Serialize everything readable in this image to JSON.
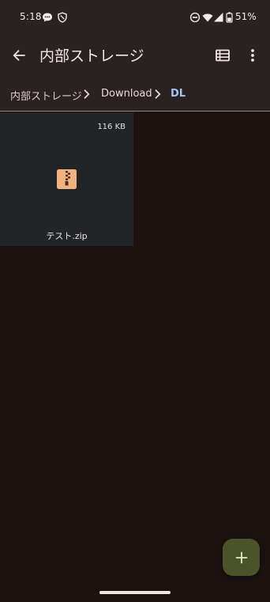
{
  "status_bar": {
    "time": "5:18",
    "battery": "51%",
    "icons": [
      "message-icon",
      "vpn-shield-icon",
      "do-not-disturb-icon",
      "wifi-icon",
      "cellular-signal-icon",
      "battery-icon"
    ]
  },
  "app_bar": {
    "title": "内部ストレージ",
    "back_icon": "back-arrow-icon",
    "list_view_icon": "list-view-icon",
    "more_icon": "more-vert-icon"
  },
  "breadcrumb": {
    "items": [
      "内部ストレージ",
      "Download",
      "DL"
    ],
    "separator_icon": "chevron-right-icon"
  },
  "files": [
    {
      "name": "テスト.zip",
      "size": "116 KB",
      "icon": "zip-file-icon",
      "icon_color": "#f2b27f"
    }
  ],
  "fab": {
    "icon": "plus-icon",
    "color": "#4a5329"
  },
  "colors": {
    "background": "#1b1210",
    "app_bar": "#2a2220",
    "accent_breadcrumb": "#a8c4f2",
    "file_card": "#222528"
  }
}
